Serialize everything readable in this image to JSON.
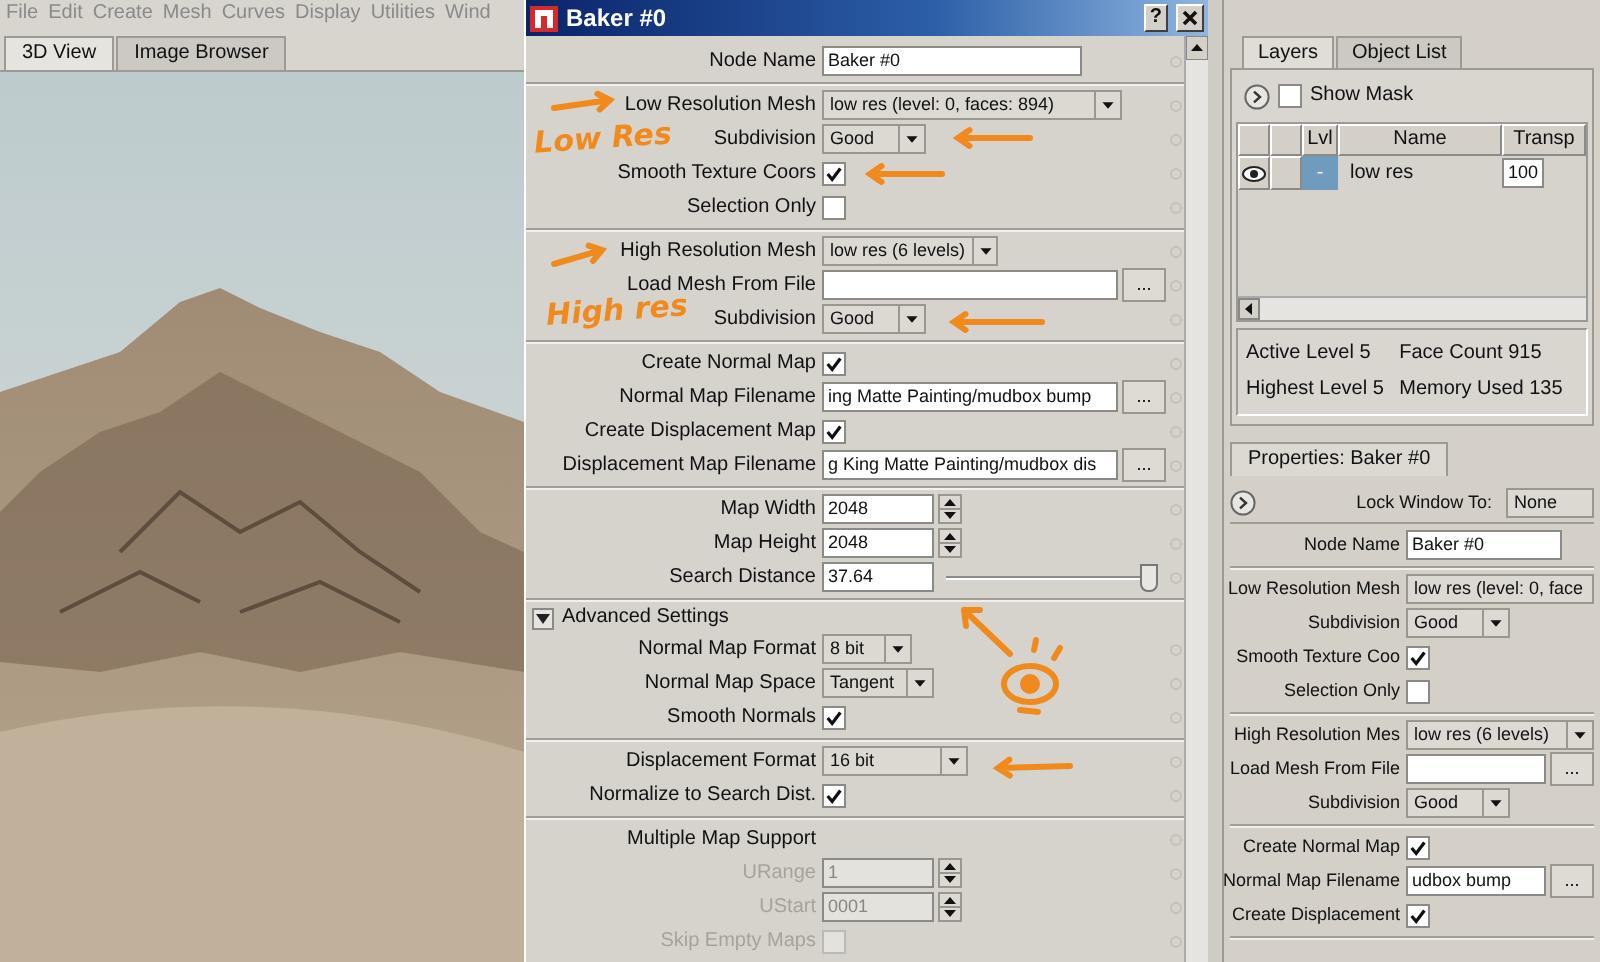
{
  "menubar": [
    "File",
    "Edit",
    "Create",
    "Mesh",
    "Curves",
    "Display",
    "Utilities",
    "Wind"
  ],
  "view_tabs": [
    {
      "label": "3D View",
      "selected": true
    },
    {
      "label": "Image Browser",
      "selected": false
    }
  ],
  "dialog": {
    "title": "Baker #0",
    "help_button": "?",
    "sections": [
      [
        {
          "kind": "text",
          "label": "Node Name",
          "value": "Baker #0",
          "disabled": false
        }
      ],
      [
        {
          "kind": "dropdown",
          "label": "Low Resolution Mesh",
          "value": "low res (level: 0, faces: 894)",
          "disabled": false
        },
        {
          "kind": "dropdown",
          "label": "Subdivision",
          "value": "Good",
          "disabled": false
        },
        {
          "kind": "checkbox",
          "label": "Smooth Texture Coors",
          "checked": true,
          "disabled": false
        },
        {
          "kind": "checkbox",
          "label": "Selection Only",
          "checked": false,
          "disabled": false
        }
      ],
      [
        {
          "kind": "dropdown",
          "label": "High Resolution Mesh",
          "value": "low res (6 levels)",
          "disabled": false
        },
        {
          "kind": "file",
          "label": "Load Mesh From File",
          "button": "...",
          "disabled": false
        },
        {
          "kind": "dropdown",
          "label": "Subdivision",
          "value": "Good",
          "disabled": false
        }
      ],
      [
        {
          "kind": "checkbox",
          "label": "Create Normal Map",
          "checked": true,
          "disabled": false
        },
        {
          "kind": "file",
          "label": "Normal Map Filename",
          "value": "ing Matte Painting/mudbox bump",
          "button": "...",
          "disabled": false
        },
        {
          "kind": "checkbox",
          "label": "Create Displacement Map",
          "checked": true,
          "disabled": false
        },
        {
          "kind": "file",
          "label": "Displacement Map Filename",
          "value": "g King Matte Painting/mudbox dis",
          "button": "...",
          "disabled": false
        }
      ],
      [
        {
          "kind": "spin",
          "label": "Map Width",
          "value": "2048",
          "disabled": false
        },
        {
          "kind": "spin",
          "label": "Map Height",
          "value": "2048",
          "disabled": false
        },
        {
          "kind": "slider",
          "label": "Search Distance",
          "value": "37.64",
          "level": 1,
          "disabled": false
        }
      ],
      [
        {
          "kind": "expander",
          "label": "Advanced Settings",
          "expanded": true,
          "disabled": false
        },
        {
          "kind": "dropdown",
          "label": "Normal Map Format",
          "value": "8 bit",
          "disabled": false
        },
        {
          "kind": "dropdown",
          "label": "Normal Map Space",
          "value": "Tangent",
          "disabled": false
        },
        {
          "kind": "checkbox",
          "label": "Smooth Normals",
          "checked": true,
          "disabled": false
        }
      ],
      [
        {
          "kind": "dropdown",
          "label": "Displacement Format",
          "value": "16 bit",
          "disabled": false
        },
        {
          "kind": "checkbox",
          "label": "Normalize to Search Dist.",
          "checked": true,
          "disabled": false
        }
      ],
      [
        {
          "kind": "heading",
          "label": "Multiple Map Support",
          "disabled": false
        },
        {
          "kind": "spin",
          "label": "URange",
          "value": "1",
          "disabled": true
        },
        {
          "kind": "spin",
          "label": "UStart",
          "value": "0001",
          "disabled": true
        },
        {
          "kind": "checkbox",
          "label": "Skip Empty Maps",
          "checked": false,
          "disabled": true
        }
      ]
    ]
  },
  "annotations": [
    {
      "kind": "arrow_right"
    },
    {
      "kind": "text",
      "text": "Low Res"
    },
    {
      "kind": "arrow_left"
    },
    {
      "kind": "arrow_left"
    },
    {
      "kind": "arrow_right"
    },
    {
      "kind": "text",
      "text": "High res"
    },
    {
      "kind": "arrow_left"
    },
    {
      "kind": "eye"
    },
    {
      "kind": "arrow_left"
    }
  ],
  "layers_panel": {
    "tabs": [
      {
        "label": "Layers",
        "selected": true
      },
      {
        "label": "Object List",
        "selected": false
      }
    ],
    "show_mask": {
      "label": "Show Mask",
      "checked": false
    },
    "columns": [
      "Lvl",
      "Name",
      "Transp"
    ],
    "rows": [
      {
        "visible": true,
        "level": "-",
        "name": "low res",
        "transparency": "100"
      }
    ],
    "stats": [
      {
        "label": "Active Level",
        "value": "5"
      },
      {
        "label": "Face Count",
        "value": "915"
      },
      {
        "label": "Highest Level",
        "value": "5"
      },
      {
        "label": "Memory Used",
        "value": "135"
      }
    ]
  },
  "properties_panel": {
    "tab": "Properties: Baker #0",
    "lock_label": "Lock Window To:",
    "lock_value": "None",
    "sections": [
      [
        {
          "kind": "text",
          "label": "Node Name",
          "value": "Baker #0",
          "disabled": false
        }
      ],
      [
        {
          "kind": "dropdown",
          "label": "Low Resolution Mesh",
          "value": "low res (level: 0, face",
          "disabled": false
        },
        {
          "kind": "dropdown",
          "label": "Subdivision",
          "value": "Good",
          "disabled": false
        },
        {
          "kind": "checkbox",
          "label": "Smooth Texture Coo",
          "checked": true,
          "disabled": false
        },
        {
          "kind": "checkbox",
          "label": "Selection Only",
          "checked": false,
          "disabled": false
        }
      ],
      [
        {
          "kind": "dropdown",
          "label": "High Resolution Mes",
          "value": "low res (6 levels)",
          "disabled": false
        },
        {
          "kind": "file",
          "label": "Load Mesh From File",
          "button": "...",
          "disabled": false
        },
        {
          "kind": "dropdown",
          "label": "Subdivision",
          "value": "Good",
          "disabled": false
        }
      ],
      [
        {
          "kind": "checkbox",
          "label": "Create Normal Map",
          "checked": true,
          "disabled": false
        },
        {
          "kind": "file",
          "label": "Normal Map Filename",
          "value": "udbox bump",
          "button": "...",
          "disabled": false
        },
        {
          "kind": "checkbox",
          "label": "Create Displacement",
          "checked": true,
          "disabled": false
        }
      ]
    ]
  }
}
